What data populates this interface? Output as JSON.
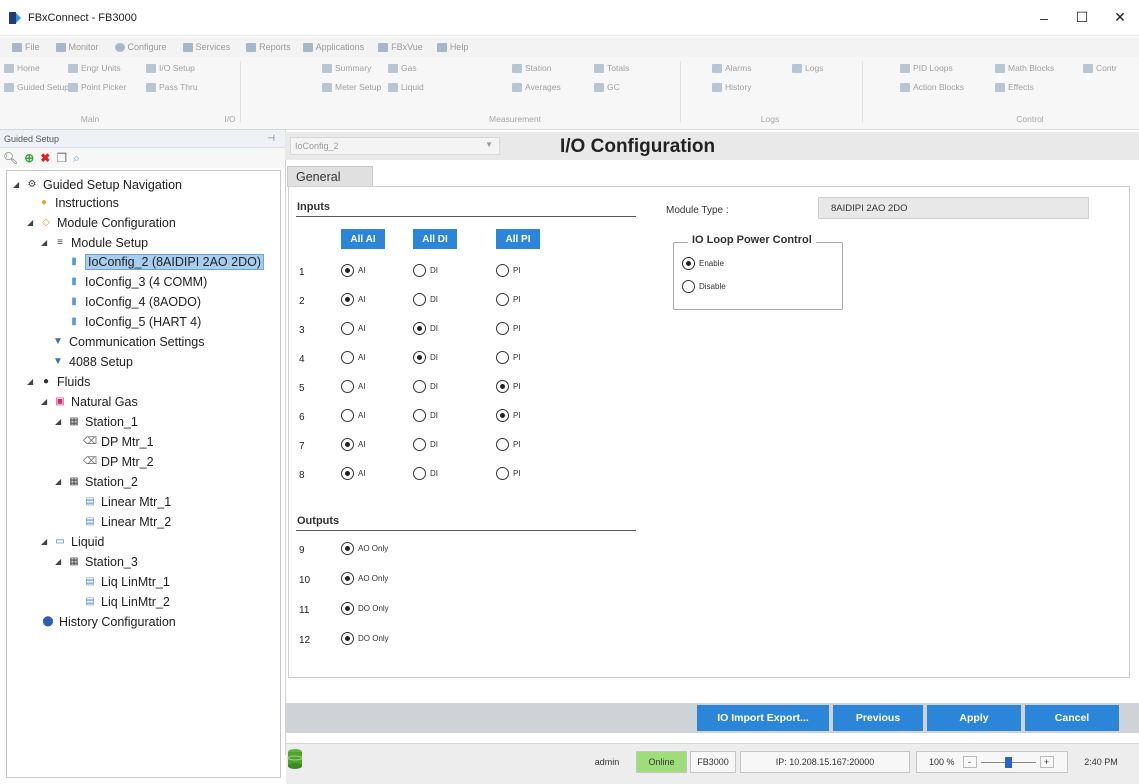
{
  "window": {
    "title": "FBxConnect - FB3000",
    "min": "–",
    "max": "☐",
    "close": "✕"
  },
  "menu": [
    "File",
    "Monitor",
    "Configure",
    "Services",
    "Reports",
    "Applications",
    "FBxVue",
    "Help"
  ],
  "ribbon": {
    "main": {
      "home": "Home",
      "engr_units": "Engr Units",
      "io_setup": "I/O Setup",
      "guided_setup": "Guided Setup",
      "point_picker": "Point Picker",
      "pass_thru": "Pass Thru"
    },
    "groups": {
      "main": "Main",
      "io": "I/O",
      "measurement": "Measurement",
      "logs": "Logs",
      "control": "Control"
    },
    "measurement": {
      "summary": "Summary",
      "gas": "Gas",
      "station": "Station",
      "totals": "Totals",
      "meter_setup": "Meter Setup",
      "liquid": "Liquid",
      "averages": "Averages",
      "gc": "GC"
    },
    "logs": {
      "alarms": "Alarms",
      "logs": "Logs",
      "history": "History"
    },
    "control": {
      "pid_loops": "PID Loops",
      "math_blocks": "Math Blocks",
      "contr": "Contr",
      "action_blocks": "Action Blocks",
      "effects": "Effects"
    }
  },
  "guided_setup": {
    "header": "Guided Setup",
    "pin": "⊣",
    "tree": [
      {
        "label": "Guided Setup Navigation"
      },
      {
        "label": "Instructions"
      },
      {
        "label": "Module Configuration"
      },
      {
        "label": "Module Setup"
      },
      {
        "label": "IoConfig_2 (8AIDIPI 2AO 2DO)"
      },
      {
        "label": "IoConfig_3 (4 COMM)"
      },
      {
        "label": "IoConfig_4 (8AODO)"
      },
      {
        "label": "IoConfig_5 (HART 4)"
      },
      {
        "label": "Communication Settings"
      },
      {
        "label": "4088 Setup"
      },
      {
        "label": "Fluids"
      },
      {
        "label": "Natural Gas"
      },
      {
        "label": "Station_1"
      },
      {
        "label": "DP Mtr_1"
      },
      {
        "label": "DP Mtr_2"
      },
      {
        "label": "Station_2"
      },
      {
        "label": "Linear Mtr_1"
      },
      {
        "label": "Linear Mtr_2"
      },
      {
        "label": "Liquid"
      },
      {
        "label": "Station_3"
      },
      {
        "label": "Liq LinMtr_1"
      },
      {
        "label": "Liq LinMtr_2"
      },
      {
        "label": "History Configuration"
      }
    ]
  },
  "main": {
    "crumb": "IoConfig_2",
    "title": "I/O Configuration",
    "tab": "General",
    "inputs_label": "Inputs",
    "outputs_label": "Outputs",
    "all_buttons": {
      "ai": "All AI",
      "di": "All DI",
      "pi": "All PI"
    },
    "input_option_labels": {
      "ai": "AI",
      "di": "DI",
      "pi": "PI"
    },
    "inputs": [
      {
        "num": "1",
        "selected": "AI"
      },
      {
        "num": "2",
        "selected": "AI"
      },
      {
        "num": "3",
        "selected": "DI"
      },
      {
        "num": "4",
        "selected": "DI"
      },
      {
        "num": "5",
        "selected": "PI"
      },
      {
        "num": "6",
        "selected": "PI"
      },
      {
        "num": "7",
        "selected": "AI"
      },
      {
        "num": "8",
        "selected": "AI"
      }
    ],
    "outputs": [
      {
        "num": "9",
        "label": "AO Only"
      },
      {
        "num": "10",
        "label": "AO Only"
      },
      {
        "num": "11",
        "label": "DO Only"
      },
      {
        "num": "12",
        "label": "DO Only"
      }
    ],
    "module_type_label": "Module Type :",
    "module_type_value": "8AIDIPI 2AO 2DO",
    "loop_power": {
      "title": "IO Loop Power Control",
      "enable": "Enable",
      "disable": "Disable",
      "selected": "Enable"
    }
  },
  "footer_buttons": {
    "import_export": "IO Import Export...",
    "previous": "Previous",
    "apply": "Apply",
    "cancel": "Cancel"
  },
  "status": {
    "user": "admin",
    "state": "Online",
    "device": "FB3000",
    "ip": "IP: 10.208.15.167:20000",
    "zoom": "100 %",
    "zoom_minus": "-",
    "zoom_plus": "+",
    "time": "2:40 PM"
  },
  "colors": {
    "accent": "#2b86d9",
    "online": "#9fdc7a",
    "selection": "#a9cdef"
  }
}
